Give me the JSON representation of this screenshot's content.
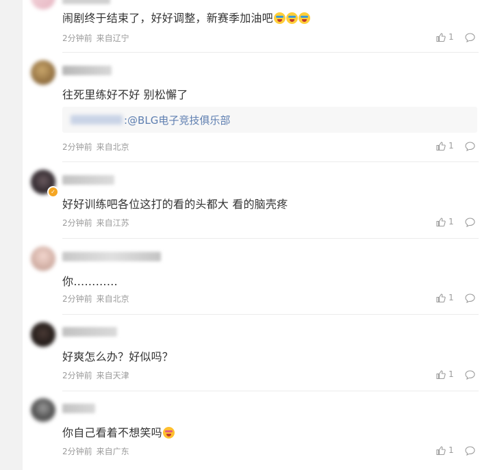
{
  "comments": [
    {
      "text": "闹剧终于结束了，好好调整，新赛季加油吧",
      "emojis": [
        "tear-face-icon",
        "tear-face-icon",
        "tear-face-icon"
      ],
      "time": "2分钟前",
      "location": "来自辽宁",
      "likes": "1"
    },
    {
      "text": "往死里练好不好 别松懈了",
      "quote": {
        "mention": ":@BLG电子竞技俱乐部"
      },
      "time": "2分钟前",
      "location": "来自北京",
      "likes": "1"
    },
    {
      "text": "好好训练吧各位这打的看的头都大 看的脑壳疼",
      "time": "2分钟前",
      "location": "来自江苏",
      "likes": "1"
    },
    {
      "text": "你…………",
      "time": "2分钟前",
      "location": "来自北京",
      "likes": "1"
    },
    {
      "text": "好爽怎么办？好似吗？",
      "time": "2分钟前",
      "location": "来自天津",
      "likes": "1"
    },
    {
      "text": "你自己看着不想笑吗",
      "emojis": [
        "laugh-face-icon"
      ],
      "time": "2分钟前",
      "location": "来自广东",
      "likes": "1"
    }
  ],
  "colors": {
    "text": "#333333",
    "meta": "#9b9b9b",
    "link": "#5d7eb0",
    "badge": "#f5a623"
  }
}
